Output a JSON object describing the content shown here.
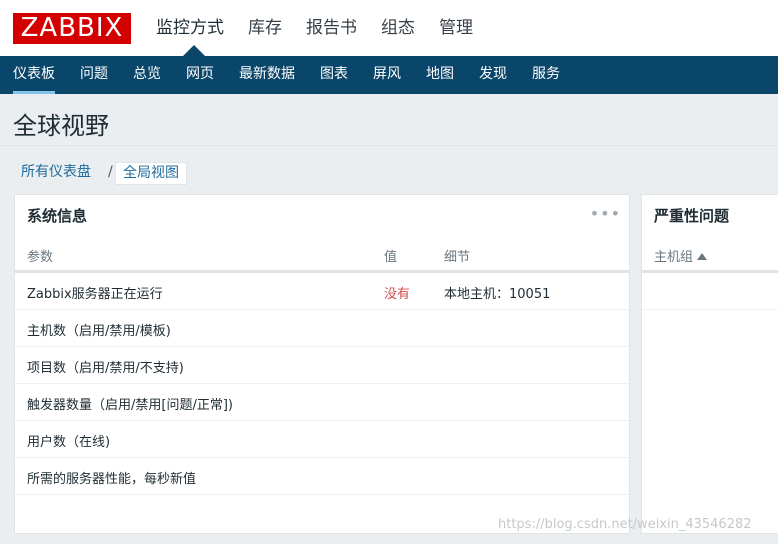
{
  "header": {
    "logo": "ZABBIX",
    "menu": [
      "监控方式",
      "库存",
      "报告书",
      "组态",
      "管理"
    ]
  },
  "subnav": [
    "仪表板",
    "问题",
    "总览",
    "网页",
    "最新数据",
    "图表",
    "屏风",
    "地图",
    "发现",
    "服务"
  ],
  "page": {
    "title": "全球视野"
  },
  "breadcrumb": {
    "parent": "所有仪表盘",
    "separator": "/",
    "current": "全局视图"
  },
  "sysinfo": {
    "title": "系统信息",
    "menu_icon": "more-dots",
    "columns": [
      "参数",
      "值",
      "细节"
    ],
    "rows": [
      {
        "param": "Zabbix服务器正在运行",
        "value": "没有",
        "detail": "本地主机：10051"
      },
      {
        "param": "主机数（启用/禁用/模板)",
        "value": "",
        "detail": ""
      },
      {
        "param": "项目数（启用/禁用/不支持)",
        "value": "",
        "detail": ""
      },
      {
        "param": "触发器数量（启用/禁用[问题/正常])",
        "value": "",
        "detail": ""
      },
      {
        "param": "用户数（在线)",
        "value": "",
        "detail": ""
      },
      {
        "param": "所需的服务器性能，每秒新值",
        "value": "",
        "detail": ""
      }
    ]
  },
  "problems": {
    "title": "严重性问题",
    "column": "主机组"
  },
  "watermark": "https://blog.csdn.net/weixin_43546282",
  "colors": {
    "brand": "#d40000",
    "nav": "#0a466a",
    "link": "#1f6b9d",
    "alert": "#d64e4e"
  }
}
